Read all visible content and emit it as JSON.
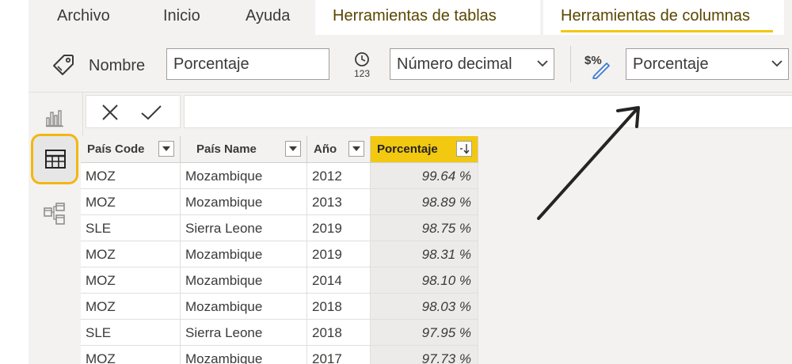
{
  "ribbon": {
    "tabs": [
      "Archivo",
      "Inicio",
      "Ayuda"
    ],
    "context_tabs": [
      "Herramientas de tablas",
      "Herramientas de columnas"
    ]
  },
  "toolbar": {
    "name_label": "Nombre",
    "name_value": "Porcentaje",
    "data_type_value": "Número decimal",
    "format_value": "Porcentaje"
  },
  "table": {
    "columns": [
      "País Code",
      "País Name",
      "Año",
      "Porcentaje"
    ],
    "rows": [
      [
        "MOZ",
        "Mozambique",
        "2012",
        "99.64 %"
      ],
      [
        "MOZ",
        "Mozambique",
        "2013",
        "98.89 %"
      ],
      [
        "SLE",
        "Sierra Leone",
        "2019",
        "98.75 %"
      ],
      [
        "MOZ",
        "Mozambique",
        "2019",
        "98.31 %"
      ],
      [
        "MOZ",
        "Mozambique",
        "2014",
        "98.10 %"
      ],
      [
        "MOZ",
        "Mozambique",
        "2018",
        "98.03 %"
      ],
      [
        "SLE",
        "Sierra Leone",
        "2018",
        "97.95 %"
      ],
      [
        "MOZ",
        "Mozambique",
        "2017",
        "97.73 %"
      ]
    ]
  },
  "colors": {
    "accent": "#f2c811",
    "selected_border": "#f2b70f"
  },
  "icons": [
    "tag-icon",
    "data-type-icon",
    "format-icon",
    "chevron-down-icon",
    "report-view-icon",
    "data-view-icon",
    "model-view-icon",
    "cancel-icon",
    "commit-icon",
    "filter-icon",
    "sort-descending-icon"
  ]
}
